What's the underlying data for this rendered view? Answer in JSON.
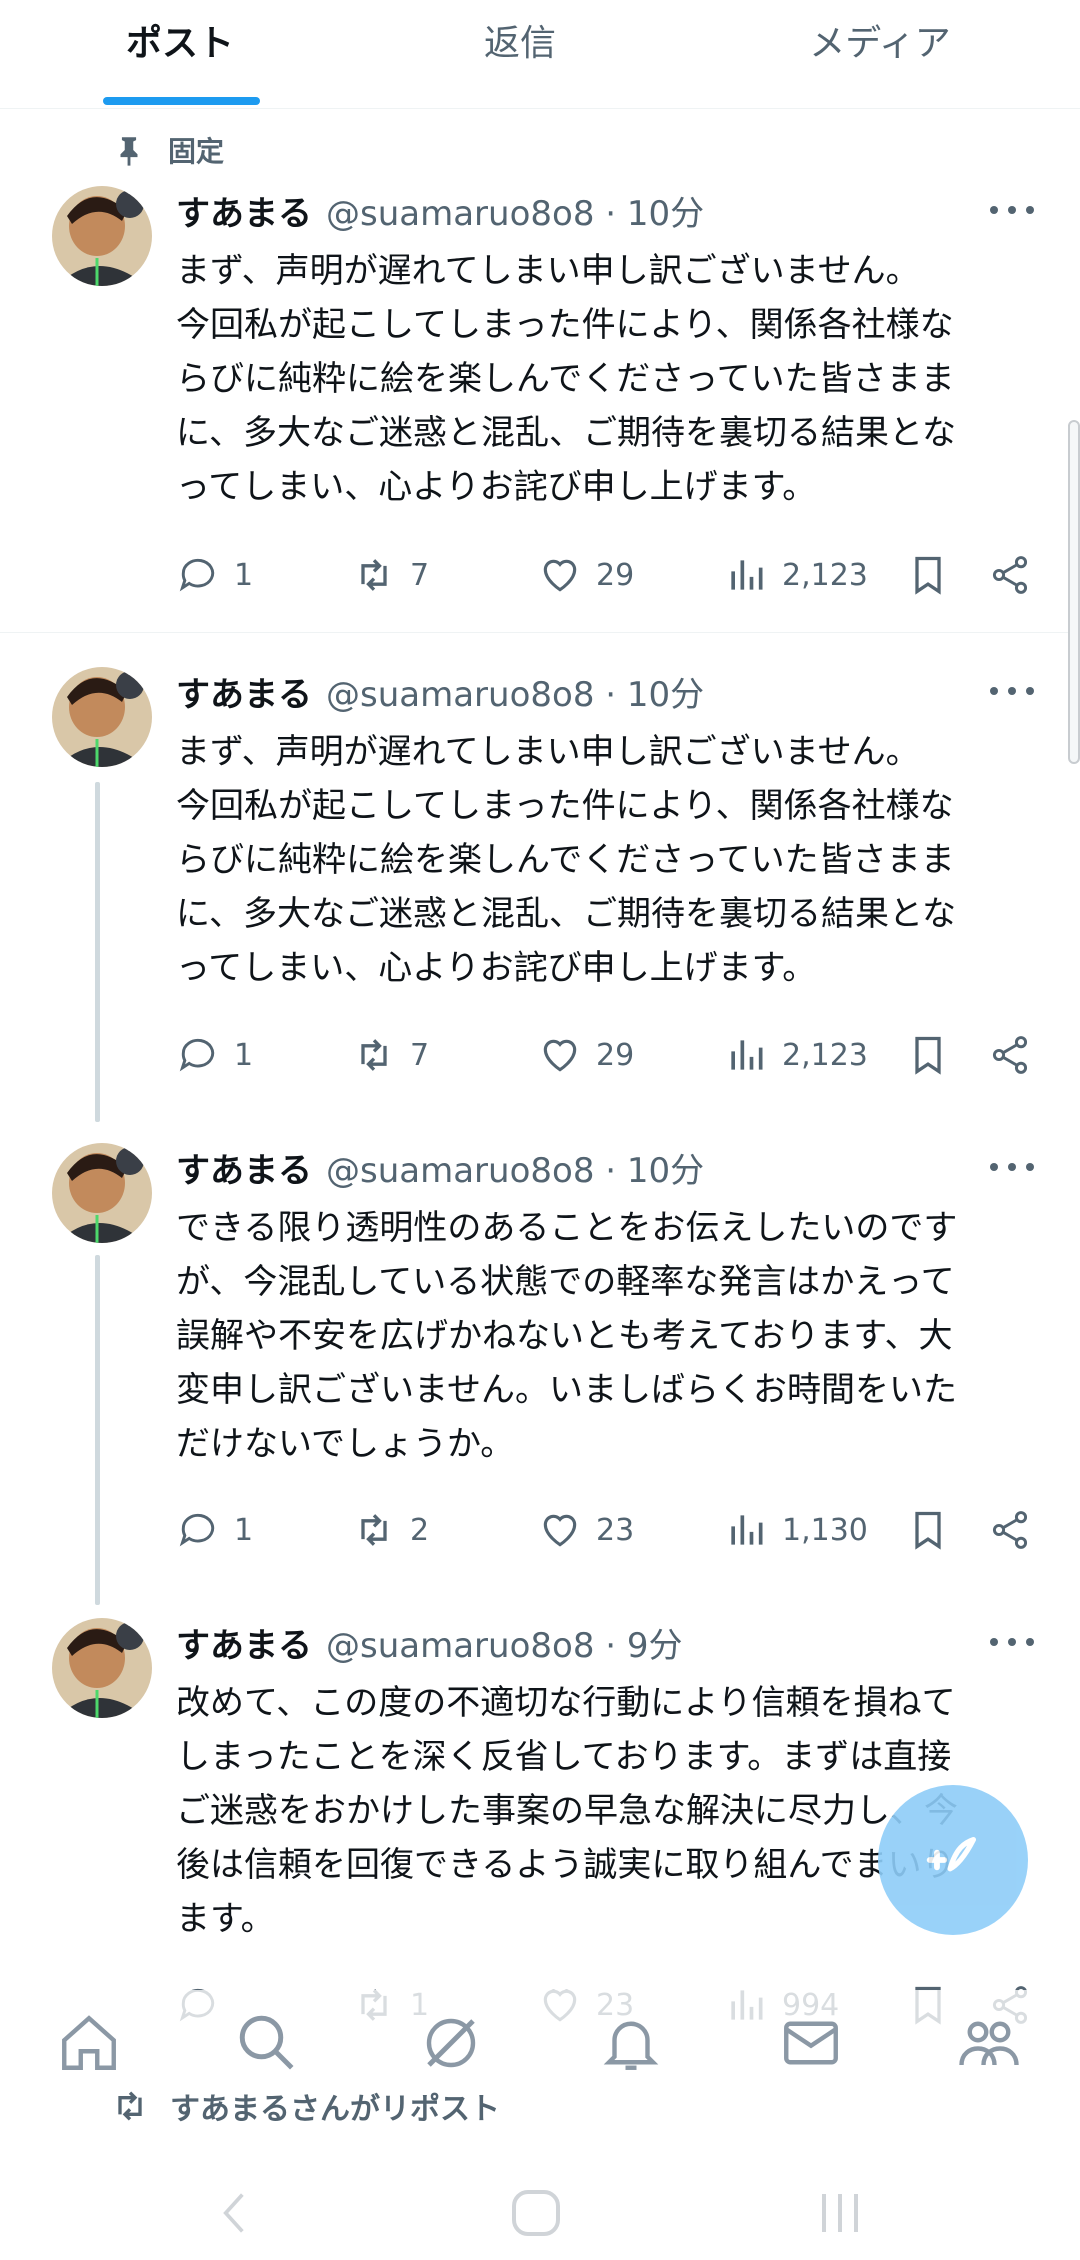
{
  "tabs": [
    {
      "label": "ポスト",
      "active": true
    },
    {
      "label": "返信",
      "active": false
    },
    {
      "label": "メディア",
      "active": false
    }
  ],
  "pinned_label": "固定",
  "posts": [
    {
      "name": "すあまる",
      "meta": "@suamaruo8o8 · 10分",
      "lines": [
        "まず、声明が遅れてしまい申し訳ございません。",
        "今回私が起こしてしまった件により、関係各社様な",
        "らびに純粋に絵を楽しんでくださっていた皆さまま",
        "に、多大なご迷惑と混乱、ご期待を裏切る結果とな",
        "ってしまい、心よりお詫び申し上げます。"
      ],
      "replies": "1",
      "reposts": "7",
      "likes": "29",
      "views": "2,123"
    },
    {
      "name": "すあまる",
      "meta": "@suamaruo8o8 · 10分",
      "lines": [
        "まず、声明が遅れてしまい申し訳ございません。",
        "今回私が起こしてしまった件により、関係各社様な",
        "らびに純粋に絵を楽しんでくださっていた皆さまま",
        "に、多大なご迷惑と混乱、ご期待を裏切る結果とな",
        "ってしまい、心よりお詫び申し上げます。"
      ],
      "replies": "1",
      "reposts": "7",
      "likes": "29",
      "views": "2,123"
    },
    {
      "name": "すあまる",
      "meta": "@suamaruo8o8 · 10分",
      "lines": [
        "できる限り透明性のあることをお伝えしたいのです",
        "が、今混乱している状態での軽率な発言はかえって",
        "誤解や不安を広げかねないとも考えております、大",
        "変申し訳ございません。いましばらくお時間をいた",
        "だけないでしょうか。"
      ],
      "replies": "1",
      "reposts": "2",
      "likes": "23",
      "views": "1,130"
    },
    {
      "name": "すあまる",
      "meta": "@suamaruo8o8 · 9分",
      "lines": [
        "改めて、この度の不適切な行動により信頼を損ねて",
        "しまったことを深く反省しております。まずは直接",
        "ご迷惑をおかけした事案の早急な解決に尽力し、今",
        "後は信頼を回復できるよう誠実に取り組んでまいり",
        "ます。"
      ],
      "replies": "",
      "reposts": "1",
      "likes": "23",
      "views": "994"
    }
  ],
  "repost_banner": "すあまるさんがリポスト",
  "icons": {
    "pin": "pin-icon",
    "reply": "reply-icon",
    "repost": "repost-icon",
    "like": "heart-icon",
    "views": "views-icon",
    "bookmark": "bookmark-icon",
    "share": "share-icon",
    "compose": "compose-icon",
    "home": "home-icon",
    "search": "search-icon",
    "grok": "grok-icon",
    "notifications": "bell-icon",
    "messages": "mail-icon",
    "communities": "communities-icon"
  },
  "colors": {
    "accent": "#1d9bf0",
    "text": "#0f1419",
    "muted": "#536471",
    "thread_line": "#cfd9de"
  }
}
